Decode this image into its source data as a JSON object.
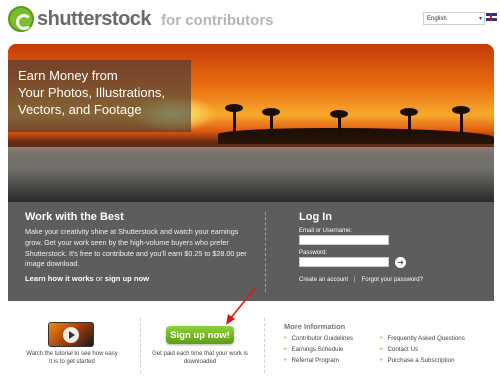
{
  "header": {
    "logo_text": "shutterstock",
    "logo_tag": "for contributors",
    "language": "English",
    "language_arrow": "▾"
  },
  "hero": {
    "lines": [
      "Earn Money from",
      "Your Photos, Illustrations,",
      "Vectors, and Footage"
    ]
  },
  "work": {
    "title": "Work with the Best",
    "body": "Make your creativity shine at Shutterstock and watch your earnings grow. Get your work seen by the high-volume buyers who prefer Shutterstock. It's free to contribute and you'll earn $0.25 to $28.00 per image download.",
    "learn_link": "Learn how it works",
    "or": " or ",
    "signup_link": "sign up now"
  },
  "login": {
    "title": "Log In",
    "email_label": "Email or Username:",
    "password_label": "Password:",
    "go_icon": "➔",
    "create_account": "Create an account",
    "separator": "|",
    "forgot_password": "Forgot your password?"
  },
  "tutorial": {
    "text": "Watch the tutorial to see how easy it is to get started"
  },
  "signup": {
    "button_label": "Sign up now!",
    "text": "Get paid each time that your work is downloaded"
  },
  "more_info": {
    "title": "More Information",
    "col1": [
      "Contributor Guidelines",
      "Earnings Schedule",
      "Referral Program"
    ],
    "col2": [
      "Frequently Asked Questions",
      "Contact Us",
      "Purchase a Subscription"
    ]
  },
  "colors": {
    "brand_green": "#7bbd2a",
    "panel_gray": "#5e5d5c",
    "arrow_red": "#d21a1a"
  }
}
